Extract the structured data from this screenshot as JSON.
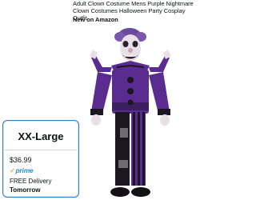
{
  "listing": {
    "title": "Adult Clown Costume Mens Purple Nightmare Clown Costumes Halloween Party Cosplay Outfit",
    "source_badge": "New on Amazon"
  },
  "size_card": {
    "size": "XX-Large",
    "price": "$36.99",
    "prime_label": "prime",
    "delivery_label": "FREE Delivery",
    "delivery_date": "Tomorrow",
    "border_color": "#2f7fd0",
    "prime_color": "#2a8fd6"
  },
  "image": {
    "subject": "clown-costume-photo",
    "colors": {
      "purple": "#5a2c8f",
      "black": "#1b1620",
      "skin": "#e9dfe6",
      "gray_legs": "#6f6a74"
    }
  }
}
